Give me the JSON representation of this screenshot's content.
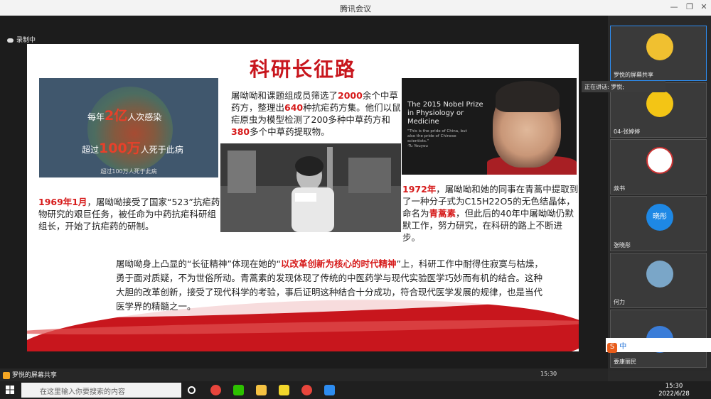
{
  "window": {
    "title": "腾讯会议"
  },
  "recording": {
    "label": "录制中"
  },
  "slide": {
    "title": "科研长征路",
    "malaria_image": {
      "line1_pre": "每年",
      "line1_num": "2亿",
      "line1_post": "人次感染",
      "line2_pre": "超过",
      "line2_num": "100万",
      "line2_post": "人死于此病",
      "caption": "超过100万人死于此病"
    },
    "screen_text": {
      "p1": "屠呦呦和课题组成员筛选了",
      "n1": "2000",
      "p2": "余个中草药方，整理出",
      "n2": "640",
      "p3": "种抗疟药方集。他们以鼠疟原虫为模型检测了200多种中草药方和",
      "n3": "380",
      "p4": "多个中草药提取物。"
    },
    "nobel_image": {
      "heading": "The 2015 Nobel Prize in Physiology or Medicine",
      "quote": "\"This is the pride of China, but also the pride of Chinese scientists.\"",
      "attribution": "-Tu Youyou"
    },
    "text_1969": {
      "year": "1969年1月",
      "body": "，屠呦呦接受了国家“523”抗疟药物研究的艰巨任务，被任命为中药抗疟科研组组长，开始了抗疟药的研制。"
    },
    "text_1972": {
      "year": "1972年",
      "body1": "，屠呦呦和她的同事在青蒿中提取到了一种分子式为C15H22O5的无色结晶体，命名为",
      "name": "青蒿素",
      "body2": "，但此后的40年中屠呦呦仍默默工作，努力研究，在科研的路上不断进步。"
    },
    "bottom": {
      "p1": "屠呦呦身上凸显的“长征精神”体现在她的“",
      "highlight": "以改革创新为核心的时代精神",
      "p2": "”上，科研工作中耐得住寂寞与枯燥，勇于面对质疑，不为世俗所动。青蒿素的发现体现了传统的中医药学与现代实验医学巧妙而有机的结合。这种大胆的改革创新，接受了现代科学的考验，事后证明这种结合十分成功，符合现代医学发展的规律，也是当代医学界的精髓之一。"
    }
  },
  "meeting_bar": {
    "share_label": "罗悦的屏幕共享",
    "time": "15:30"
  },
  "participants": [
    {
      "name": "罗悦的屏幕共享",
      "color": "#f0c030"
    },
    {
      "name": "04-张婷婷",
      "color": "#f3c515"
    },
    {
      "name": "燚书",
      "color": "#ffffff"
    },
    {
      "name": "张晓彤",
      "color": "#1e88e5",
      "avatar_text": "晓彤"
    },
    {
      "name": "何力",
      "color": "#7aa6c8"
    },
    {
      "name": "要康丽民",
      "color": "#3b7dd8"
    }
  ],
  "speaking": {
    "label": "正在讲话: 罗悦;"
  },
  "ime": {
    "label": "中"
  },
  "taskbar": {
    "search_placeholder": "在这里输入你要搜索的内容"
  },
  "clock": {
    "time": "15:30",
    "date": "2022/6/28"
  }
}
